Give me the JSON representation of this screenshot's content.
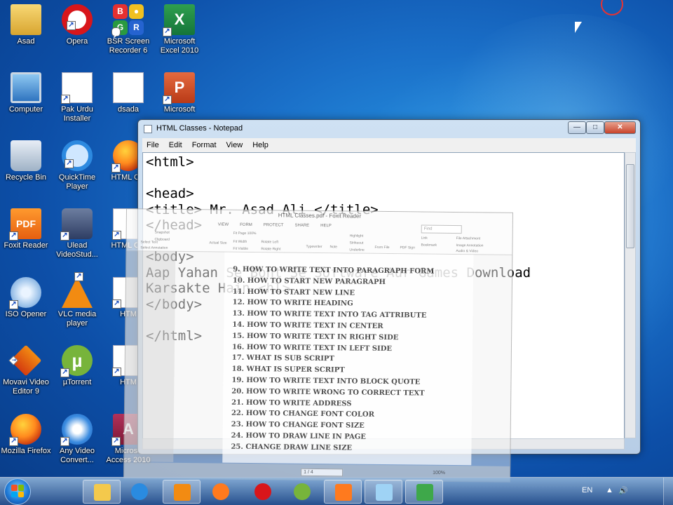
{
  "desktop_icons": [
    {
      "label": "Asad",
      "icon": "user-folder-icon"
    },
    {
      "label": "Opera",
      "icon": "opera-icon"
    },
    {
      "label": "BSR Screen Recorder 6",
      "icon": "bsr-recorder-icon"
    },
    {
      "label": "Microsoft Excel 2010",
      "icon": "excel-icon"
    },
    {
      "label": "Computer",
      "icon": "computer-icon"
    },
    {
      "label": "Pak Urdu Installer",
      "icon": "firefox-doc-icon"
    },
    {
      "label": "dsada",
      "icon": "text-file-icon"
    },
    {
      "label": "Microsoft",
      "icon": "powerpoint-icon"
    },
    {
      "label": "Recycle Bin",
      "icon": "recycle-bin-icon"
    },
    {
      "label": "QuickTime Player",
      "icon": "quicktime-icon"
    },
    {
      "label": "HTML Cla",
      "icon": "firefox-html-icon"
    },
    {
      "label": "Foxit Reader",
      "icon": "foxit-icon"
    },
    {
      "label": "Ulead VideoStud...",
      "icon": "ulead-icon"
    },
    {
      "label": "HTML Cla",
      "icon": "html-doc-icon"
    },
    {
      "label": "ISO Opener",
      "icon": "iso-opener-icon"
    },
    {
      "label": "VLC media player",
      "icon": "vlc-icon"
    },
    {
      "label": "HTM",
      "icon": "html-doc-icon"
    },
    {
      "label": "Movavi Video Editor 9",
      "icon": "movavi-icon"
    },
    {
      "label": "µTorrent",
      "icon": "utorrent-icon"
    },
    {
      "label": "HTM",
      "icon": "word-doc-icon"
    },
    {
      "label": "Mozilla Firefox",
      "icon": "firefox-icon"
    },
    {
      "label": "Any Video Convert...",
      "icon": "any-video-converter-icon"
    },
    {
      "label": "Microso Access 2010",
      "icon": "access-icon"
    }
  ],
  "notepad": {
    "title": "HTML Classes - Notepad",
    "menu": [
      "File",
      "Edit",
      "Format",
      "View",
      "Help"
    ],
    "content": "<html>\n\n<head>\n<title> Mr. Asad Ali </title>\n</head>\n\n<body>\nAap Yahan Se Boht Se Software Aur Games Download\nKarsakte Hain <hl>\n</body>\n\n</html>",
    "buttons": {
      "minimize": "—",
      "maximize": "□",
      "close": "✕"
    }
  },
  "foxit": {
    "title": "HTML Classes.pdf - Foxit Reader",
    "tabs": [
      "VIEW",
      "FORM",
      "PROTECT",
      "SHARE",
      "HELP"
    ],
    "search_placeholder": "Find",
    "toolbar": [
      "Snapshot",
      "Clipboard",
      "Select Text",
      "Select Annotation",
      "Actual Size",
      "Fit Page",
      "Fit Width",
      "Fit Visible",
      "Rotate Left",
      "Rotate Right",
      "Typewriter",
      "Note",
      "Highlight",
      "Strikeout",
      "Underline",
      "From File",
      "PDF Sign",
      "Link",
      "Bookmark",
      "File Attachment",
      "Image Annotation",
      "Audio & Video"
    ],
    "zoom_select": "100%",
    "page_items": [
      "9. HOW TO WRITE TEXT INTO PARAGRAPH FORM",
      "10. HOW TO START NEW PARAGRAPH",
      "11. HOW TO START NEW LINE",
      "12. HOW TO WRITE HEADING",
      "13. HOW TO WRITE TEXT INTO TAG ATTRIBUTE",
      "14. HOW TO WRITE TEXT IN CENTER",
      "15. HOW TO WRITE TEXT IN RIGHT SIDE",
      "16. HOW TO WRITE TEXT IN LEFT SIDE",
      "17. WHAT IS SUB SCRIPT",
      "18. WHAT IS SUPER SCRIPT",
      "19. HOW TO WRITE TEXT INTO BLOCK QUOTE",
      "20. HOW TO WRITE WRONG TO CORRECT TEXT",
      "21. HOW TO WRITE ADDRESS",
      "22. HOW TO CHANGE FONT COLOR",
      "23. HOW TO CHANGE FONT SIZE",
      "24. HOW TO DRAW LINE IN PAGE",
      "25. CHANGE DRAW LINE SIZE"
    ],
    "page_indicator": "1 / 4",
    "zoom_level": "100%"
  },
  "taskbar": {
    "items": [
      "explorer-icon",
      "ie-icon",
      "media-player-icon",
      "firefox-icon",
      "opera-icon",
      "utorrent-icon",
      "foxit-icon",
      "notepad-icon",
      "idm-icon"
    ],
    "language": "EN"
  },
  "colors": {
    "accent_red": "#e53333",
    "taskbar": "#3b6aa3"
  }
}
